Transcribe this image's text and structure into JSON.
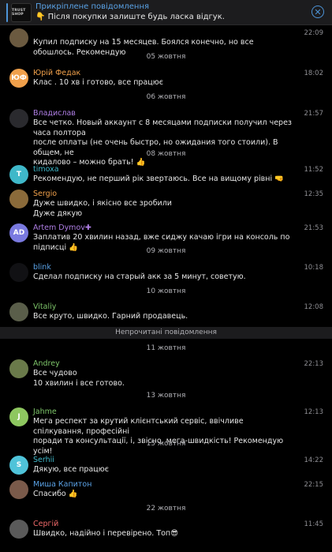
{
  "pinned": {
    "title": "Прикріплене повідомлення",
    "text": "👇 Після покупки залиште будь ласка відгук.",
    "thumb_label": "TRUST SHOP"
  },
  "messages": [
    {
      "name": "",
      "time": "22:09",
      "text": [
        "Купил подписку на 15 месяцев. Боялся конечно, но все обошлось. Рекомендую"
      ],
      "avatar": "",
      "avatar_color": "#6b5a40",
      "name_color": "#e6e6e6"
    },
    {
      "name": "Юрій Федак",
      "time": "18:02",
      "text": [
        "Клас . 10 хв і готово, все працює"
      ],
      "avatar": "ЮФ",
      "avatar_color": "#f0a04b",
      "name_color": "#f0a04b"
    },
    {
      "name": "Владислав",
      "time": "21:57",
      "text": [
        "Все четко. Новый аккаунт с 8 месяцами подписки получил через часа полтора",
        "после оплаты (не очень быстро, но ожидания того стоили). В общем, не",
        "кидалово – можно брать! 👍"
      ],
      "avatar": "",
      "avatar_color": "#2a2a2e",
      "name_color": "#b07fe6"
    },
    {
      "name": "timoxa",
      "time": "11:52",
      "text": [
        "Рекомендую, не перший рік звертаюсь. Все на вищому рівні 🤜"
      ],
      "avatar": "T",
      "avatar_color": "#3fb8c9",
      "name_color": "#3fb8c9"
    },
    {
      "name": "Sergio",
      "time": "12:35",
      "text": [
        "Дуже швидко, і якісно все зробили",
        "Дуже дякую"
      ],
      "avatar": "",
      "avatar_color": "#8a6a3a",
      "name_color": "#f0a04b"
    },
    {
      "name": "Artem Dymov✚",
      "time": "21:53",
      "text": [
        "Заплатив 20 хвилин назад, вже сиджу качаю ігри на консоль по підписці 👍"
      ],
      "avatar": "AD",
      "avatar_color": "#7a7ae0",
      "name_color": "#b07fe6"
    },
    {
      "name": "blink",
      "time": "10:18",
      "text": [
        "Сделал подписку на старый акк за 5 минут, советую."
      ],
      "avatar": "",
      "avatar_color": "#111114",
      "name_color": "#5aa2e6"
    },
    {
      "name": "Vitaliy",
      "time": "12:08",
      "text": [
        "Все круто, швидко. Гарний продавець."
      ],
      "avatar": "",
      "avatar_color": "#5a5e4a",
      "name_color": "#7ec66a"
    },
    {
      "name": "Andrey",
      "time": "22:13",
      "text": [
        "Все чудово",
        "10 хвилин і все готово."
      ],
      "avatar": "",
      "avatar_color": "#6a7a4a",
      "name_color": "#7ec66a"
    },
    {
      "name": "Jahme",
      "time": "12:13",
      "text": [
        "Мега респект за крутий клієнтський сервіс, ввічливе спілкування, професійні",
        "поради та консультації, і, звісно, мега-швидкість! Рекомендую усім!"
      ],
      "avatar": "J",
      "avatar_color": "#8ec760",
      "name_color": "#7ec66a"
    },
    {
      "name": "Serhii",
      "time": "14:22",
      "text": [
        "Дякую, все працює"
      ],
      "avatar": "S",
      "avatar_color": "#4fc3d9",
      "name_color": "#3fb8c9"
    },
    {
      "name": "Миша Капитон",
      "time": "22:15",
      "text": [
        "Спасибо 👍"
      ],
      "avatar": "",
      "avatar_color": "#7a5a4a",
      "name_color": "#5aa2e6"
    },
    {
      "name": "Сергій",
      "time": "11:45",
      "text": [
        "Швидко, надійно і перевірено. Топ😎"
      ],
      "avatar": "",
      "avatar_color": "#5a5a5a",
      "name_color": "#f06a6a"
    }
  ],
  "dates": [
    "05 жовтня",
    "06 жовтня",
    "08 жовтня",
    "09 жовтня",
    "10 жовтня",
    "11 жовтня",
    "13 жовтня",
    "15 жовтня",
    "22 жовтня"
  ],
  "unread_label": "Непрочитані повідомлення"
}
